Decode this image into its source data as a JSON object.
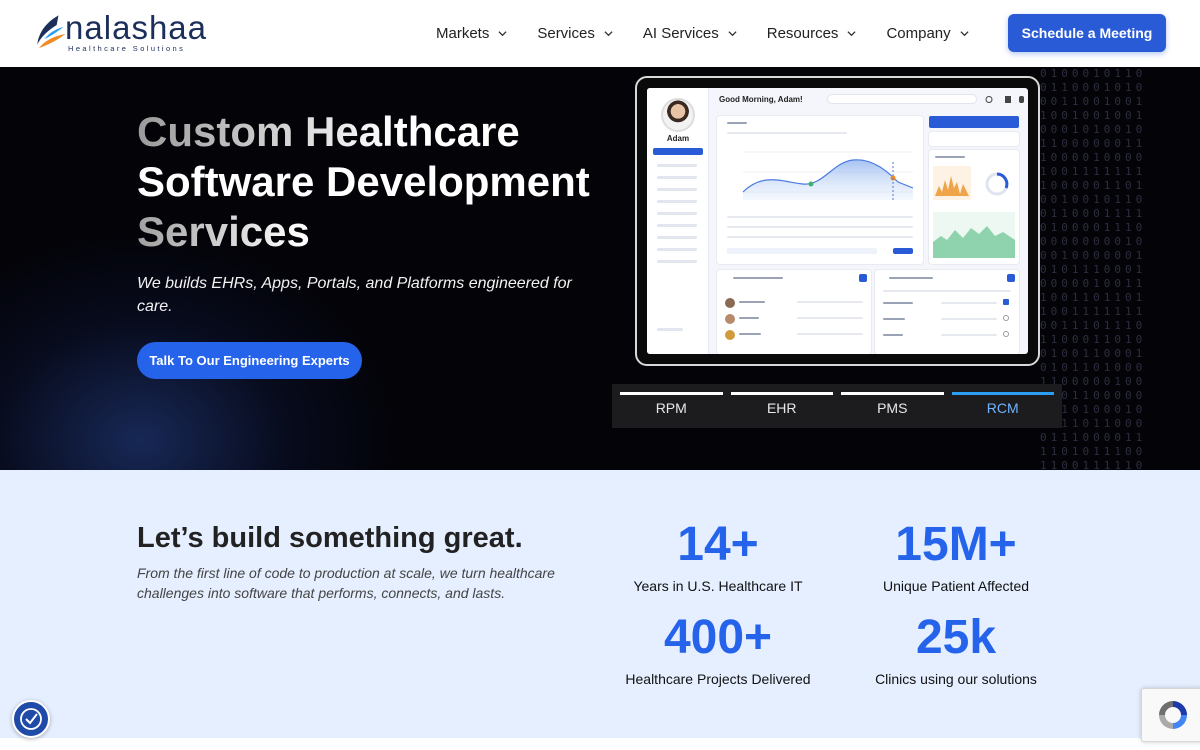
{
  "brand": {
    "name": "nalashaa",
    "tagline": "Healthcare Solutions",
    "colors": {
      "primary": "#2a5bd7",
      "navy": "#1c2e5a",
      "accent_orange": "#f08a24",
      "accent_blue": "#2a9df4"
    }
  },
  "nav": {
    "items": [
      {
        "label": "Markets"
      },
      {
        "label": "Services"
      },
      {
        "label": "AI Services"
      },
      {
        "label": "Resources"
      },
      {
        "label": "Company"
      }
    ],
    "cta_label": "Schedule a Meeting"
  },
  "hero": {
    "title_line1": "Custom Healthcare",
    "title_line2": "Software Development",
    "title_line3": "Services",
    "subtitle": "We builds EHRs, Apps, Portals, and Platforms engineered for care.",
    "cta_label": "Talk To Our Engineering Experts",
    "mockup": {
      "user_name": "Adam",
      "greeting": "Good Morning, Adam!"
    },
    "tabs": [
      {
        "label": "RPM",
        "active": false
      },
      {
        "label": "EHR",
        "active": false
      },
      {
        "label": "PMS",
        "active": false
      },
      {
        "label": "RCM",
        "active": true
      }
    ]
  },
  "stats_section": {
    "title": "Let’s build something great.",
    "subtitle": "From the first line of code to production at scale, we turn healthcare challenges into software that performs, connects, and lasts.",
    "stats": [
      {
        "value": "14+",
        "label": "Years in U.S. Healthcare IT"
      },
      {
        "value": "15M+",
        "label": "Unique Patient Affected"
      },
      {
        "value": "400+",
        "label": "Healthcare Projects Delivered"
      },
      {
        "value": "25k",
        "label": "Clinics using our solutions"
      }
    ]
  },
  "widgets": {
    "accessibility_icon": "accessibility-icon",
    "recaptcha_icon": "recaptcha-icon"
  }
}
